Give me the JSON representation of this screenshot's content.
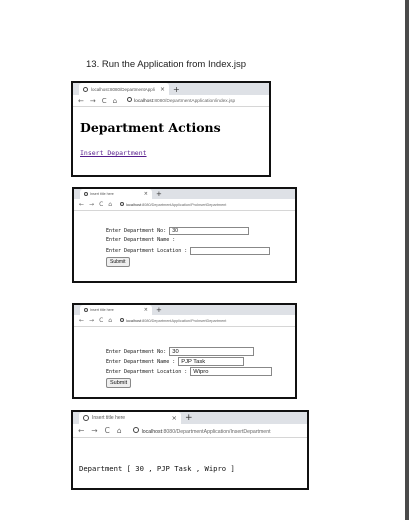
{
  "document": {
    "step_title": "13. Run the Application from Index.jsp"
  },
  "screens": [
    {
      "tab_title": "localhost:8080/DepartmentAppli",
      "url_host": "localhost",
      "url_path": ":8080/DepartmentApplication/index.jsp",
      "heading": "Department Actions",
      "link_text": "Insert Department"
    },
    {
      "tab_title": "Insert title here",
      "url_host": "localhost",
      "url_path": ":8080/DepartmentApplication/ProInsertDepartment",
      "label_no": "Enter Department No: ",
      "label_name": "Enter Department Name : ",
      "label_location": "Enter Department Location : ",
      "value_no": "30",
      "value_name": "",
      "value_location": "",
      "submit_label": "Submit"
    },
    {
      "tab_title": "Insert title here",
      "url_host": "localhost",
      "url_path": ":8080/DepartmentApplication/ProInsertDepartment",
      "label_no": "Enter Department No: ",
      "label_name": "Enter Department Name : ",
      "label_location": "Enter Department Location : ",
      "value_no": "30",
      "value_name": "PJP Task",
      "value_location": "Wipro",
      "submit_label": "Submit"
    },
    {
      "tab_title": "Insert title here",
      "url_host": "localhost",
      "url_path": ":8080/DepartmentApplication/InsertDepartment",
      "output_text": "Department [ 30 , PJP Task , Wipro ]"
    }
  ],
  "browser_chrome": {
    "close_glyph": "×",
    "new_tab_glyph": "+",
    "back_glyph": "←",
    "forward_glyph": "→",
    "reload_glyph": "C",
    "home_glyph": "⌂"
  },
  "icons": [
    "favicon-icon",
    "close-icon",
    "plus-icon",
    "back-arrow-icon",
    "forward-arrow-icon",
    "reload-icon",
    "home-icon",
    "info-globe-icon"
  ]
}
